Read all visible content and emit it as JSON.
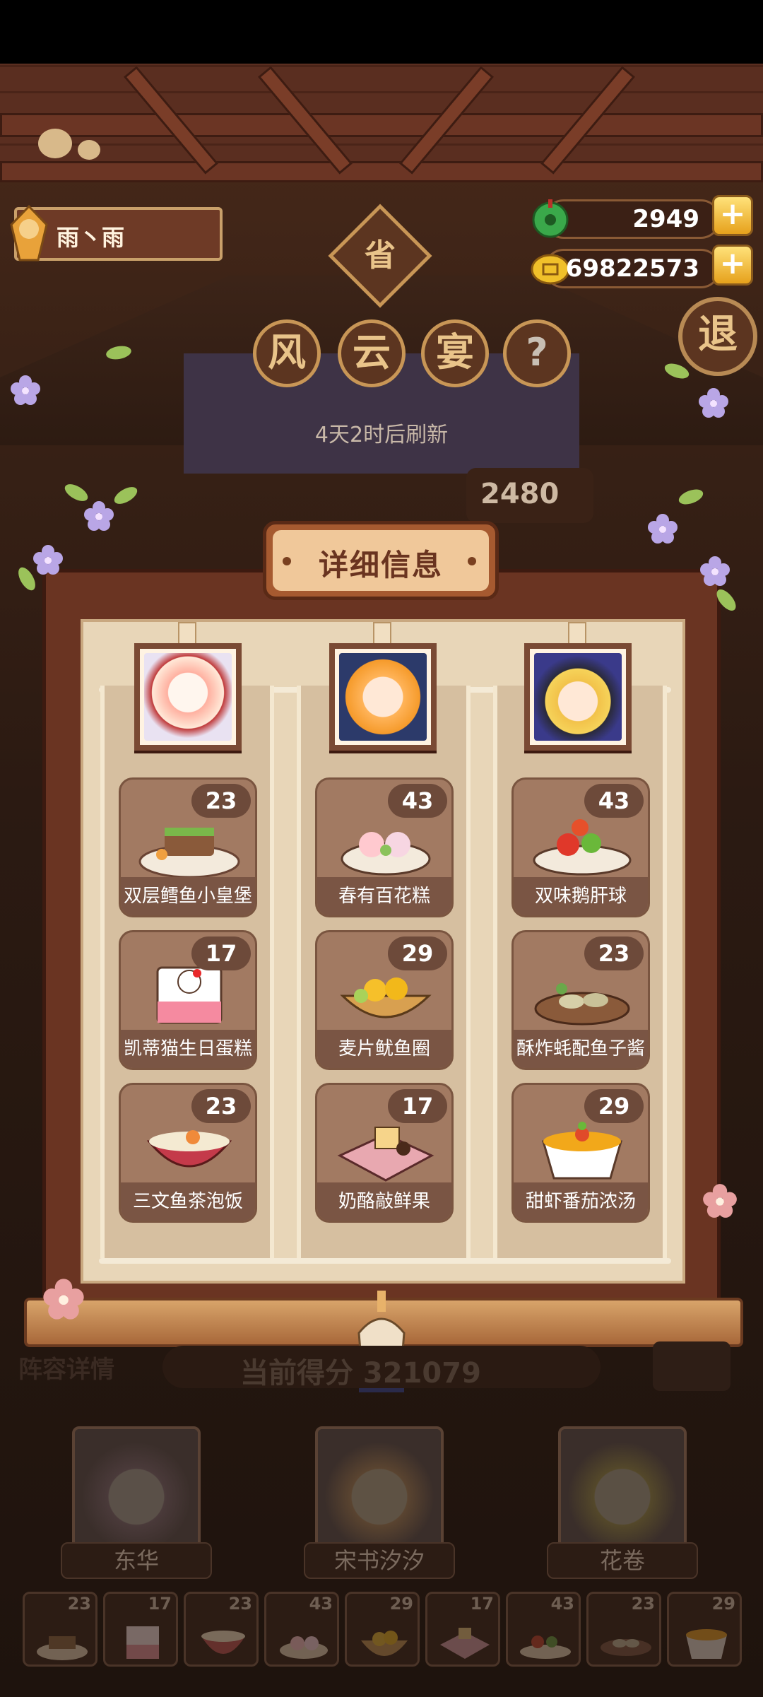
{
  "player": {
    "name": "雨丶雨"
  },
  "resources": {
    "jade": "2949",
    "coins": "69822573"
  },
  "event": {
    "province_label": "省",
    "title_chars": [
      "风",
      "云",
      "宴"
    ],
    "help_label": "?",
    "exit_label": "退",
    "refresh_text": "4天2时后刷新",
    "score_tag": "2480"
  },
  "dialog": {
    "title": "详细信息",
    "columns": [
      {
        "chef": "东华",
        "dishes": [
          {
            "name": "双层鳕鱼小皇堡",
            "count": "23"
          },
          {
            "name": "凯蒂猫生日蛋糕",
            "count": "17"
          },
          {
            "name": "三文鱼茶泡饭",
            "count": "23"
          }
        ]
      },
      {
        "chef": "宋书汐汐",
        "dishes": [
          {
            "name": "春有百花糕",
            "count": "43"
          },
          {
            "name": "麦片鱿鱼圈",
            "count": "29"
          },
          {
            "name": "奶酪敲鲜果",
            "count": "17"
          }
        ]
      },
      {
        "chef": "花卷",
        "dishes": [
          {
            "name": "双味鹅肝球",
            "count": "43"
          },
          {
            "name": "酥炸蚝配鱼子酱",
            "count": "23"
          },
          {
            "name": "甜虾番茄浓汤",
            "count": "29"
          }
        ]
      }
    ]
  },
  "lower": {
    "lineup_label": "阵容详情",
    "current_score": "当前得分 321079",
    "characters": [
      "东华",
      "宋书汐汐",
      "花卷"
    ],
    "mini_counts": [
      "23",
      "17",
      "23",
      "43",
      "29",
      "17",
      "43",
      "23",
      "29"
    ]
  },
  "colors": {
    "frame": "#6a3422",
    "paper": "#e8d6b8",
    "card": "#a27a62",
    "badge": "#6d4a3a",
    "gold": "#e6a11c"
  }
}
